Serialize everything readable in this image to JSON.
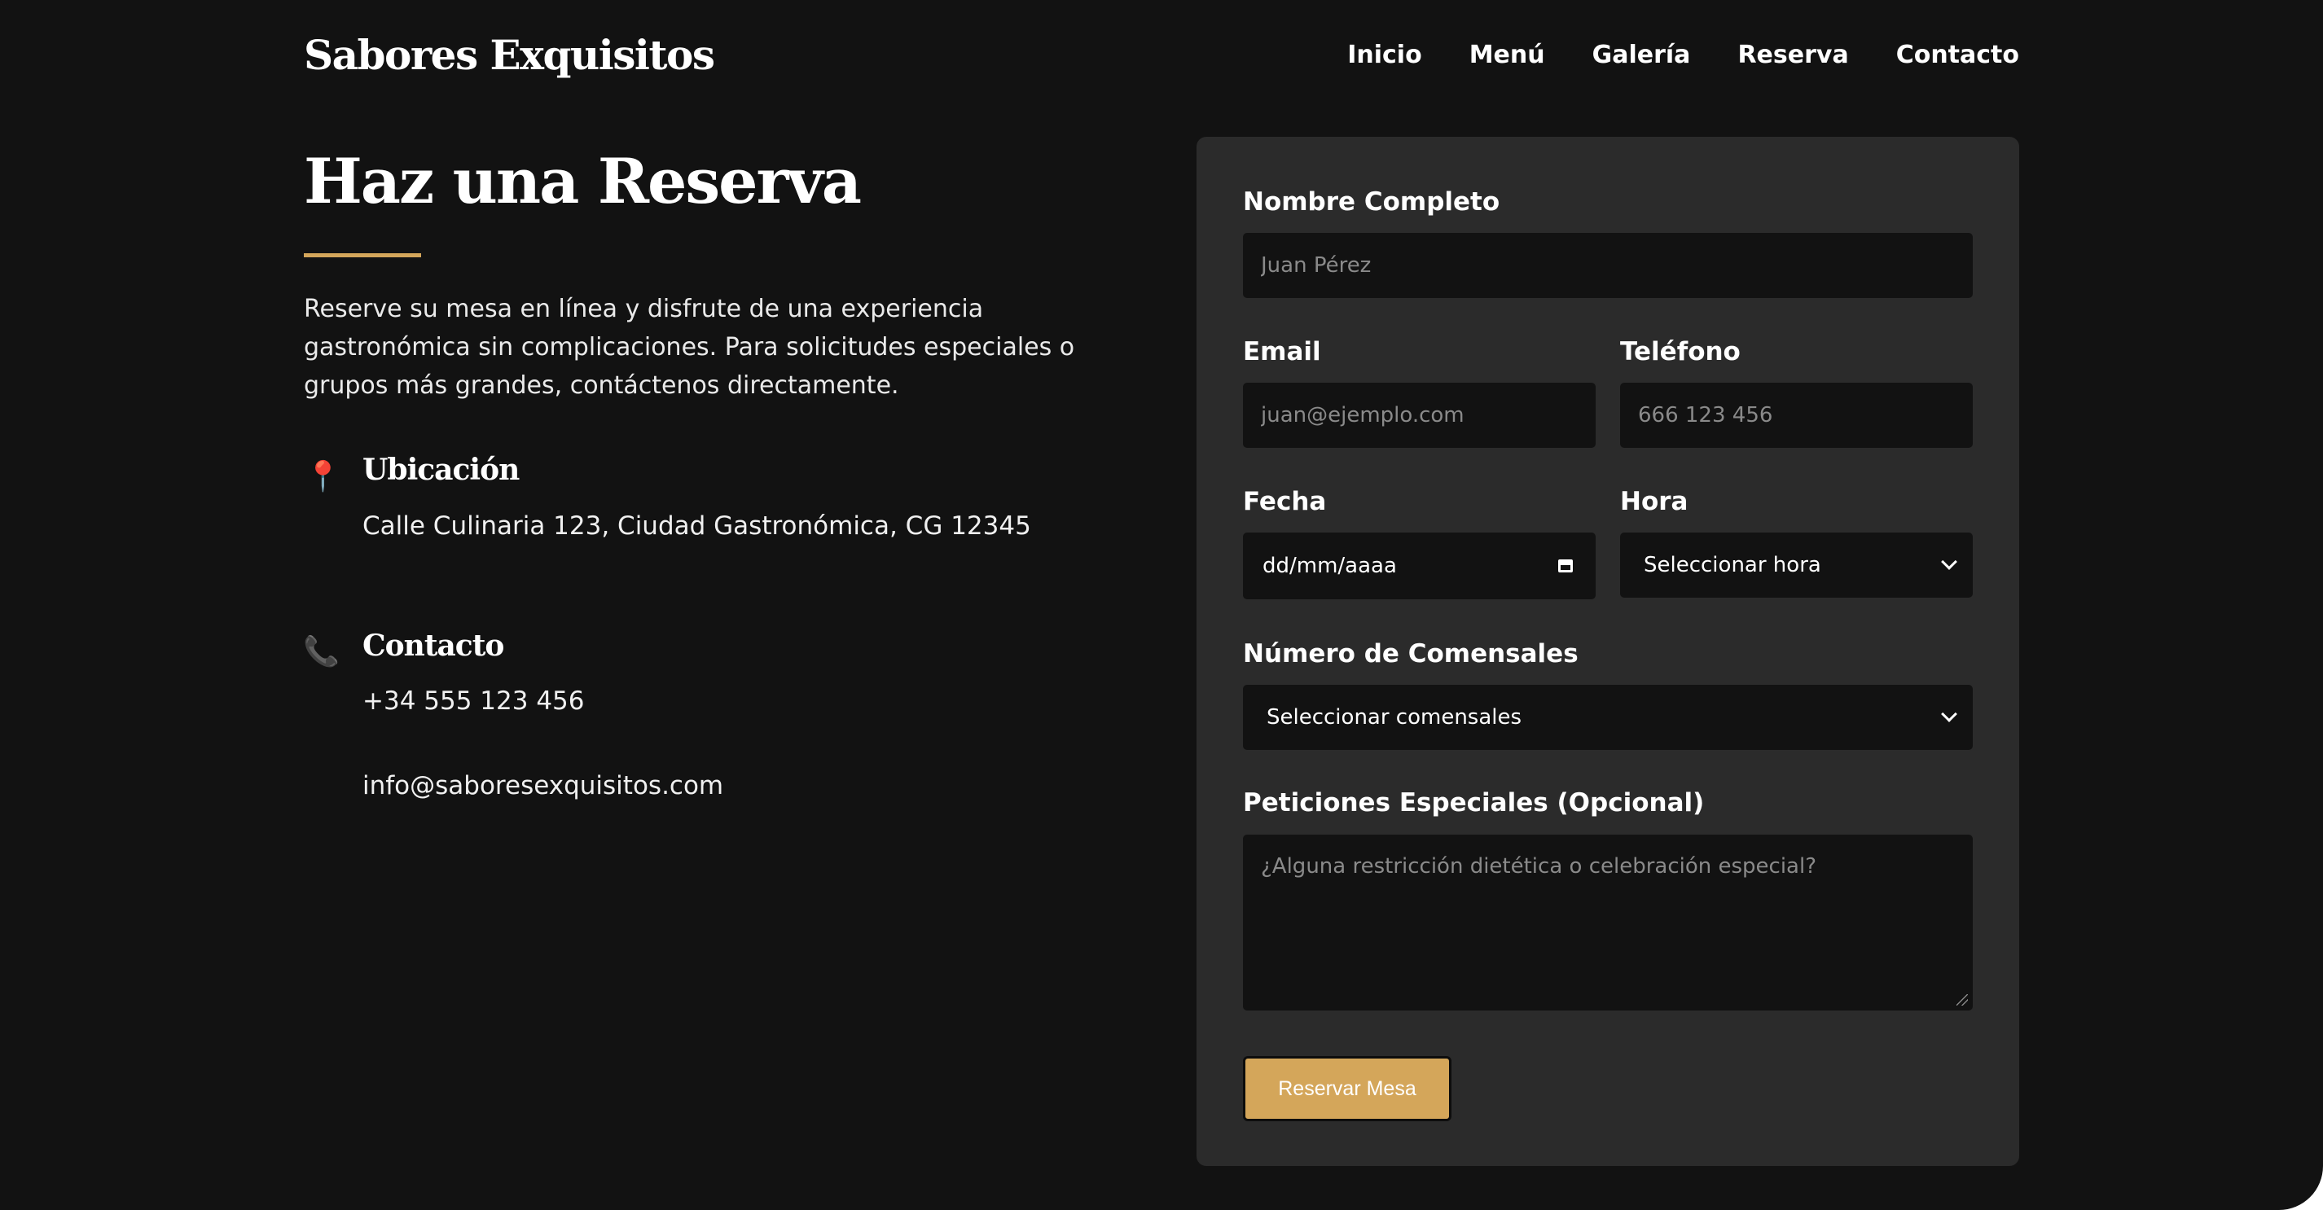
{
  "header": {
    "brand": "Sabores Exquisitos",
    "nav": [
      "Inicio",
      "Menú",
      "Galería",
      "Reserva",
      "Contacto"
    ]
  },
  "intro": {
    "title": "Haz una Reserva",
    "text": "Reserve su mesa en línea y disfrute de una experiencia gastronómica sin complicaciones. Para solicitudes especiales o grupos más grandes, contáctenos directamente.",
    "accent_color": "#d4a65a"
  },
  "location": {
    "icon": "pin-icon",
    "title": "Ubicación",
    "address": "Calle Culinaria 123, Ciudad Gastronómica, CG 12345"
  },
  "contact": {
    "icon": "phone-icon",
    "title": "Contacto",
    "phone": "+34 555 123 456",
    "email": "info@saboresexquisitos.com"
  },
  "form": {
    "name": {
      "label": "Nombre Completo",
      "placeholder": "Juan Pérez",
      "value": ""
    },
    "email": {
      "label": "Email",
      "placeholder": "juan@ejemplo.com",
      "value": ""
    },
    "phone": {
      "label": "Teléfono",
      "placeholder": "666 123 456",
      "value": ""
    },
    "date": {
      "label": "Fecha",
      "placeholder": "dd/mm/aaaa"
    },
    "time": {
      "label": "Hora",
      "selected": "Seleccionar hora"
    },
    "guests": {
      "label": "Número de Comensales",
      "selected": "Seleccionar comensales"
    },
    "requests": {
      "label": "Peticiones Especiales (Opcional)",
      "placeholder": "¿Alguna restricción dietética o celebración especial?"
    },
    "submit_label": "Reservar Mesa"
  },
  "colors": {
    "background": "#121212",
    "card": "#2b2b2b",
    "accent": "#d4a65a"
  }
}
